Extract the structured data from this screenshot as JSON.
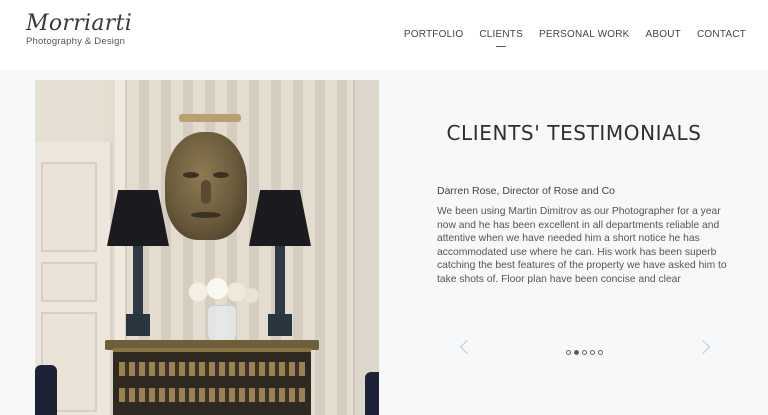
{
  "logo": {
    "script": "Morriarti",
    "subtitle": "Photography & Design"
  },
  "nav": {
    "items": [
      {
        "label": "PORTFOLIO",
        "active": false
      },
      {
        "label": "CLIENTS",
        "active": true
      },
      {
        "label": "PERSONAL WORK",
        "active": false
      },
      {
        "label": "ABOUT",
        "active": false
      },
      {
        "label": "CONTACT",
        "active": false
      }
    ]
  },
  "testimonials": {
    "title": "CLIENTS' TESTIMONIALS",
    "author": "Darren Rose, Director of Rose and Co",
    "body": "We been using Martin Dimitrov as our Photographer for a year now and he has been excellent in all departments reliable and attentive when we have needed him a short notice he has accommodated use where he can. His work has been superb catching the best features of the property we have asked him to take shots of. Floor plan have been concise and clear",
    "slide_count": 5,
    "active_slide": 2
  },
  "colors": {
    "background": "#ffffff",
    "section_background": "#f6f8fa",
    "text": "#333333"
  }
}
